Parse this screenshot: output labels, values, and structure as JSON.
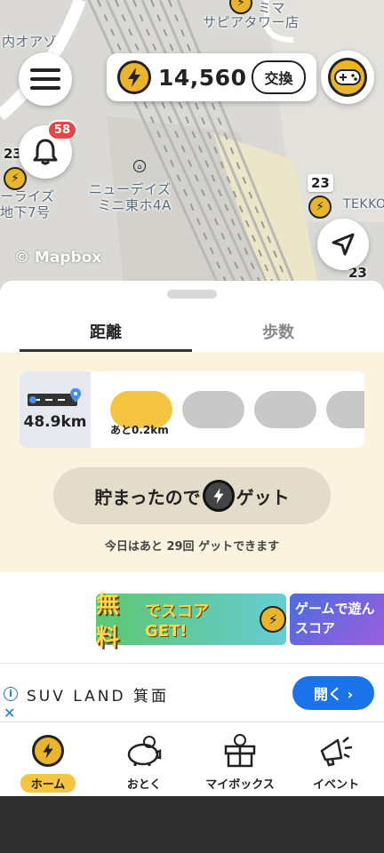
{
  "map": {
    "labels": {
      "top_store": "ミマ",
      "top_store2": "サピアタワー店",
      "left_store": "内オアゾ",
      "newdays": "ニューデイズ",
      "newdays2": "ミニ東ホ4A",
      "left_small": "ーライズ",
      "left_small2": "地下7号",
      "right_label": "TEKKO",
      "num_left": "23",
      "num_right": "23",
      "num_bottom": "23"
    },
    "attribution": "© Mapbox"
  },
  "header": {
    "coin_count": "14,560",
    "exchange_label": "交換",
    "notification_badge": "58"
  },
  "tabs": [
    {
      "label": "距離",
      "active": true
    },
    {
      "label": "歩数",
      "active": false
    }
  ],
  "progress": {
    "distance": "48.9km",
    "remaining_label": "あと0.2km"
  },
  "get_button": {
    "text_before": "貯まったので",
    "text_after": "ゲット"
  },
  "remaining_today": "今日はあと 29回 ゲットできます",
  "banners": {
    "b1_main": "無料",
    "b1_sub": "でスコア GET!",
    "b2_line1": "ゲームで遊ん",
    "b2_line2": "スコア"
  },
  "ad": {
    "title": "SUV LAND 箕面",
    "open_label": "開く ›",
    "info": "i",
    "close": "✕"
  },
  "nav": [
    {
      "label": "ホーム",
      "icon": "coin-icon",
      "active": true
    },
    {
      "label": "おとく",
      "icon": "piggy-bank-icon",
      "active": false
    },
    {
      "label": "マイボックス",
      "icon": "gift-box-icon",
      "active": false
    },
    {
      "label": "イベント",
      "icon": "megaphone-icon",
      "active": false
    }
  ],
  "colors": {
    "accent_yellow": "#f5c542",
    "panel_bg": "#f9f3df",
    "ad_blue": "#1a73e8",
    "badge_red": "#e84545"
  }
}
